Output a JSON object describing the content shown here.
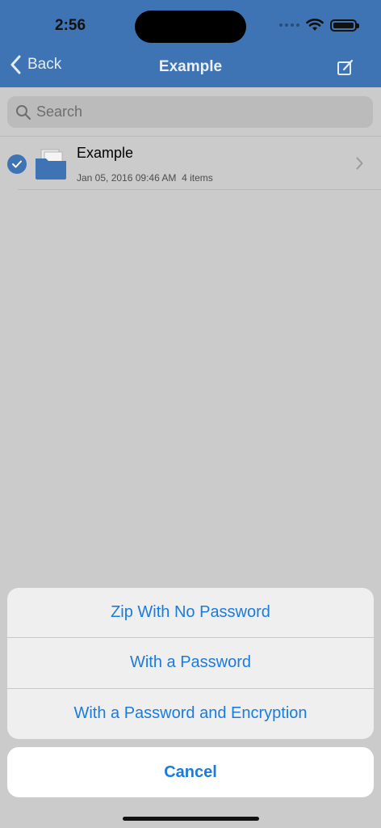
{
  "status_bar": {
    "time": "2:56"
  },
  "nav": {
    "back_label": "Back",
    "title": "Example"
  },
  "search": {
    "placeholder": "Search"
  },
  "list": {
    "items": [
      {
        "title": "Example",
        "date": "Jan 05, 2016 09:46 AM",
        "count": "4 items",
        "selected": true
      }
    ]
  },
  "action_sheet": {
    "options": [
      "Zip With No Password",
      "With a Password",
      "With a Password and Encryption"
    ],
    "cancel_label": "Cancel"
  },
  "colors": {
    "header": "#3f74b4",
    "accent": "#1a7be0",
    "folder": "#3f74b4"
  }
}
